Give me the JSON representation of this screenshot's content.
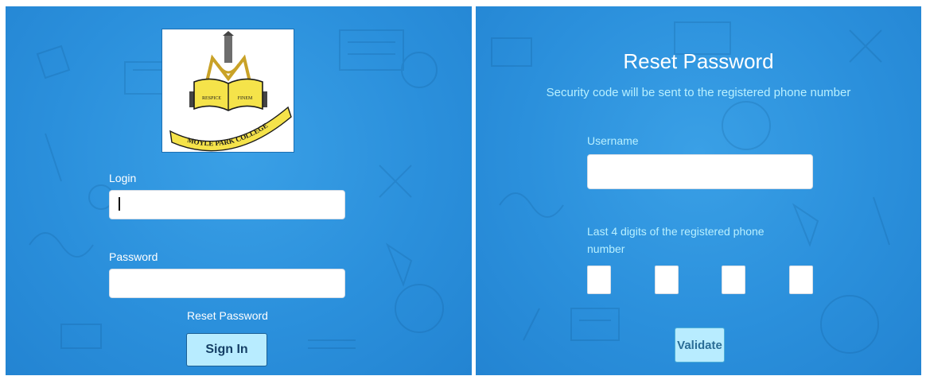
{
  "login_form": {
    "logo": {
      "motto": "RESPICE FINEM",
      "school_name": "MOYLE PARK COLLEGE"
    },
    "login_label": "Login",
    "login_value": "",
    "password_label": "Password",
    "password_value": "",
    "reset_link": "Reset Password",
    "signin_button": "Sign In"
  },
  "reset_form": {
    "title": "Reset Password",
    "subtitle": "Security code will be sent to the registered phone number",
    "username_label": "Username",
    "username_value": "",
    "digits_label": "Last 4 digits of the registered phone number",
    "digits": [
      "",
      "",
      "",
      ""
    ],
    "validate_button": "Validate"
  },
  "colors": {
    "background": "#2b90dc",
    "button_bg": "#b8ecff",
    "subtitle_text": "#b8f0ff"
  }
}
